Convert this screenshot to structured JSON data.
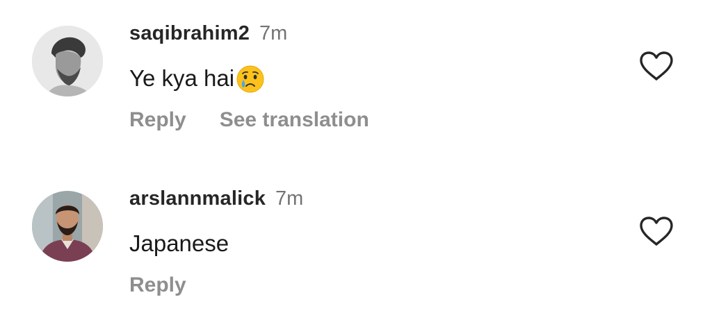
{
  "comments": [
    {
      "username": "saqibrahim2",
      "time": "7m",
      "text": "Ye kya hai",
      "emoji": "crying-face-icon",
      "actions": [
        "Reply",
        "See translation"
      ]
    },
    {
      "username": "arslannmalick",
      "time": "7m",
      "text": "Japanese",
      "actions": [
        "Reply"
      ]
    }
  ],
  "colors": {
    "username": "#262626",
    "secondary_text": "#737373",
    "action_text": "#8e8e8e",
    "icon_stroke": "#262626",
    "background": "#ffffff"
  }
}
